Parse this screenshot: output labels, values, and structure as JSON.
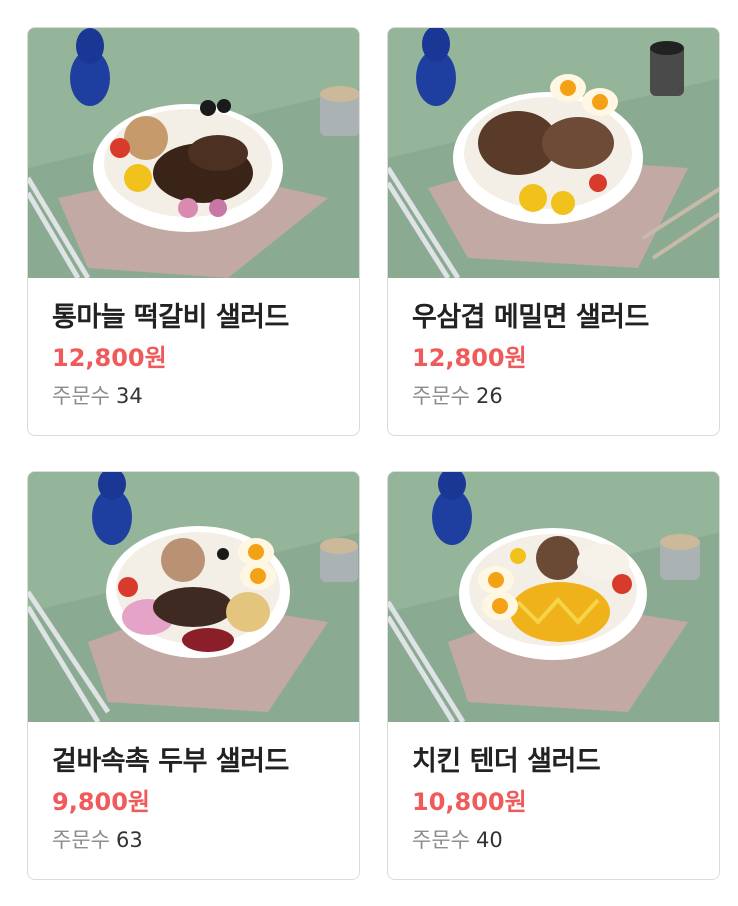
{
  "products": [
    {
      "name": "통마늘 떡갈비 샐러드",
      "price": "12,800원",
      "orders_label": "주문수",
      "orders": "34",
      "topping": "meat-glazed"
    },
    {
      "name": "우삼겹 메밀면 샐러드",
      "price": "12,800원",
      "orders_label": "주문수",
      "orders": "26",
      "topping": "noodle-beef"
    },
    {
      "name": "겉바속촉 두부 샐러드",
      "price": "9,800원",
      "orders_label": "주문수",
      "orders": "63",
      "topping": "tofu-beans"
    },
    {
      "name": "치킨 텐더 샐러드",
      "price": "10,800원",
      "orders_label": "주문수",
      "orders": "40",
      "topping": "chicken-mayo"
    }
  ],
  "colors": {
    "price": "#ef5a5a",
    "background_photo": "#8fae96",
    "border": "#dcdcdc"
  }
}
